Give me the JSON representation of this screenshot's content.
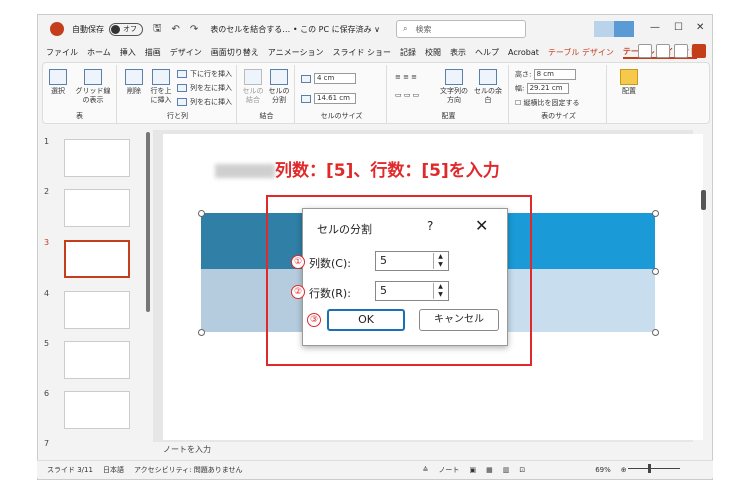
{
  "titlebar": {
    "autosave_label": "自動保存",
    "autosave_state": "オフ",
    "doc_title": "表のセルを結合する… • この PC に保存済み ∨",
    "search_placeholder": "検索"
  },
  "menu": [
    "ファイル",
    "ホーム",
    "挿入",
    "描画",
    "デザイン",
    "画面切り替え",
    "アニメーション",
    "スライド ショー",
    "記録",
    "校閲",
    "表示",
    "ヘルプ",
    "Acrobat",
    "テーブル デザイン",
    "テーブル レイアウト"
  ],
  "ribbon": {
    "table_group": {
      "label": "表",
      "select": "選択",
      "gridlines": "グリッド線の表示"
    },
    "rows_group": {
      "label": "行と列",
      "delete": "削除",
      "insert_above": "行を上に挿入",
      "insert_below": "下に行を挿入",
      "insert_left": "列を左に挿入",
      "insert_right": "列を右に挿入"
    },
    "merge_group": {
      "label": "結合",
      "merge": "セルの結合",
      "split": "セルの分割"
    },
    "cellsize_group": {
      "label": "セルのサイズ",
      "height": "4 cm",
      "width": "14.61 cm"
    },
    "align_group": {
      "label": "配置",
      "direction": "文字列の方向",
      "margins": "セルの余白"
    },
    "tablesize_group": {
      "label": "表のサイズ",
      "height_label": "高さ:",
      "height": "8 cm",
      "width_label": "幅:",
      "width": "29.21 cm",
      "lock": "縦横比を固定する"
    },
    "arrange_group": {
      "label": "",
      "arrange": "配置"
    }
  },
  "thumbnails": [
    {
      "num": "1"
    },
    {
      "num": "2"
    },
    {
      "num": "3"
    },
    {
      "num": "4"
    },
    {
      "num": "5"
    },
    {
      "num": "6"
    },
    {
      "num": "7"
    }
  ],
  "slide": {
    "headline": "列数：[5]、行数：[5]を入力"
  },
  "dialog": {
    "title": "セルの分割",
    "help": "?",
    "close": "✕",
    "cols_label": "列数(C):",
    "cols_value": "5",
    "rows_label": "行数(R):",
    "rows_value": "5",
    "ok": "OK",
    "cancel": "キャンセル",
    "markers": [
      "①",
      "②",
      "③"
    ]
  },
  "notes_placeholder": "ノートを入力",
  "status": {
    "slide": "スライド 3/11",
    "lang": "日本語",
    "accessibility": "アクセシビリティ: 問題ありません",
    "notes": "ノート",
    "zoom": "69%"
  },
  "colors": {
    "accent": "#c43e1c",
    "highlight": "#e0292a",
    "table_header": "#1a9bd7",
    "table_body": "#c8dded"
  }
}
